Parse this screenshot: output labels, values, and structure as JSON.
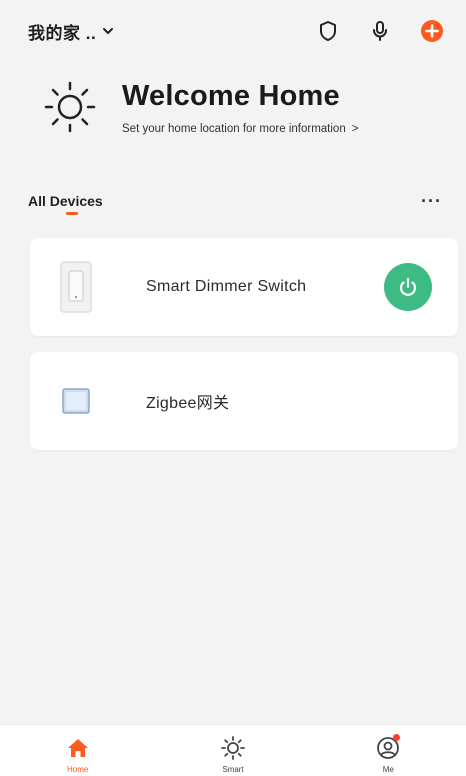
{
  "header": {
    "home_name": "我的家 ..",
    "icons": [
      "shield-icon",
      "microphone-icon",
      "add-icon"
    ],
    "add_color": "#ff5a1f"
  },
  "welcome": {
    "title": "Welcome Home",
    "subtitle": "Set your home location for more information",
    "chevron": ">",
    "icon": "sun-icon"
  },
  "devices_section": {
    "title": "All Devices",
    "more": "···",
    "accent": "#ff5a1f"
  },
  "devices": [
    {
      "name": "Smart Dimmer Switch",
      "icon": "wall-switch-icon",
      "has_power_button": true,
      "power_color": "#3dbb85"
    },
    {
      "name": "Zigbee网关",
      "icon": "gateway-icon",
      "has_power_button": false
    }
  ],
  "tabbar": {
    "tabs": [
      {
        "label": "Home",
        "icon": "home-icon",
        "active": true
      },
      {
        "label": "Smart",
        "icon": "sun-icon",
        "active": false
      },
      {
        "label": "Me",
        "icon": "user-icon",
        "active": false,
        "badge": true
      }
    ],
    "active_color": "#ff5a1f"
  }
}
